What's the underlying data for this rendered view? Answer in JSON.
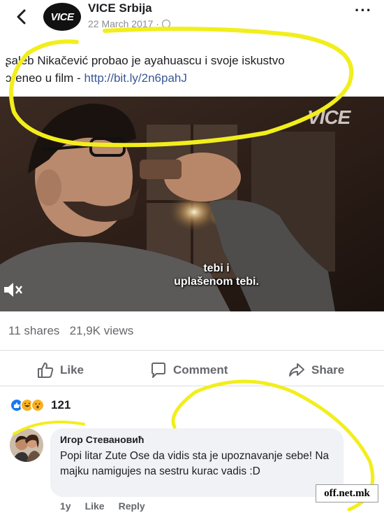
{
  "header": {
    "page_name": "VICE Srbija",
    "avatar_text": "VICE",
    "date": "22 March 2017 ·",
    "more_label": "···"
  },
  "post": {
    "text": "ʂaleb Nikačević probao je ayahuascu i svoje iskustvo",
    "text_line2": "ɔreneo u film - ",
    "link": "http://bit.ly/2n6pahJ"
  },
  "video": {
    "watermark": "VICE",
    "subtitle_line1": "tebi i",
    "subtitle_line2": "uplašenom tebi."
  },
  "stats": {
    "shares": "11 shares",
    "views": "21,9K views"
  },
  "actions": {
    "like": "Like",
    "comment": "Comment",
    "share": "Share"
  },
  "reactions": {
    "count": "121"
  },
  "comment": {
    "author": "Игор Стевановић",
    "text": "Popi litar Zute Ose da vidis sta je upoznavanje sebe! Na majku namigujes na sestru kurac vadis :D",
    "time": "1y",
    "like": "Like",
    "reply": "Reply"
  },
  "credit": {
    "text": "off.net.mk"
  },
  "colors": {
    "link": "#385898",
    "highlight": "#f2ee1c",
    "secondary_text": "#65676b"
  }
}
